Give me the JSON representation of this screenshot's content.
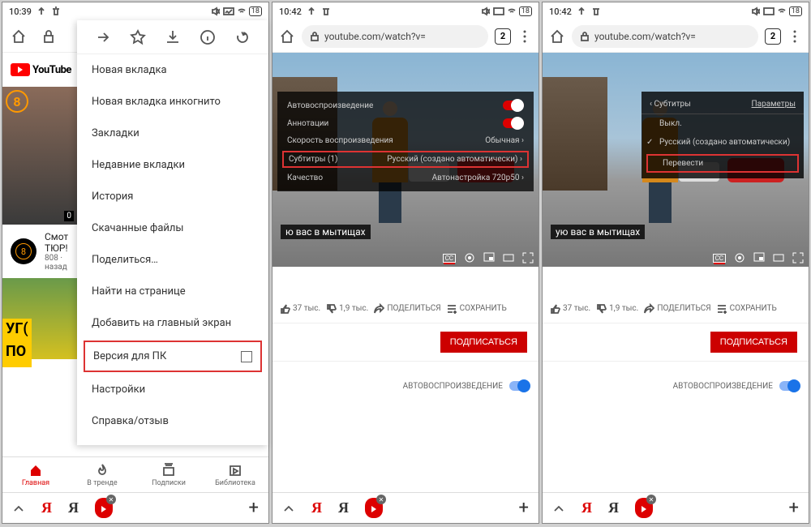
{
  "phone1": {
    "time": "10:39",
    "battery": "18",
    "menu_toolbar": [
      "forward",
      "star",
      "download",
      "info",
      "reload"
    ],
    "menu": {
      "items": [
        "Новая вкладка",
        "Новая вкладка инкогнито",
        "Закладки",
        "Недавние вкладки",
        "История",
        "Скачанные файлы",
        "Поделиться…",
        "Найти на странице",
        "Добавить на главный экран"
      ],
      "highlighted": "Версия для ПК",
      "after": [
        "Настройки",
        "Справка/отзыв"
      ]
    },
    "yt_logo": "YouTube",
    "thumb_time": "0",
    "list_title": "Смот",
    "list_title2": "ТЮР!",
    "list_meta": "808 ·",
    "list_meta2": "назад",
    "bottom_text1": "УГ(",
    "bottom_text2": "ПО",
    "nav": [
      "Главная",
      "В тренде",
      "Подписки",
      "Библиотека"
    ]
  },
  "phone2": {
    "time": "10:42",
    "battery": "18",
    "url": "youtube.com/watch?v=",
    "tabs": "2",
    "panel": {
      "autoplay": "Автовоспроизведение",
      "annotations": "Аннотации",
      "speed": "Скорость воспроизведения",
      "speed_val": "Обычная",
      "subtitles": "Субтитры (1)",
      "subtitles_val": "Русский (создано автоматически)",
      "quality": "Качество",
      "quality_val": "Автонастройка 720p50"
    },
    "subtitle_text": "ю вас в мытищах",
    "actions": {
      "like": "37 тыс.",
      "dislike": "1,9 тыс.",
      "share": "ПОДЕЛИТЬСЯ",
      "save": "СОХРАНИТЬ"
    },
    "subscribe": "ПОДПИСАТЬСЯ",
    "autoplay_label": "АВТОВОСПРОИЗВЕДЕНИЕ"
  },
  "phone3": {
    "time": "10:42",
    "battery": "18",
    "url": "youtube.com/watch?v=",
    "tabs": "2",
    "sub_panel": {
      "back": "Субтитры",
      "params": "Параметры",
      "off": "Выкл.",
      "ru": "Русский (создано автоматически)",
      "translate": "Перевести"
    },
    "subtitle_text": "ую вас в мытищах",
    "actions": {
      "like": "37 тыс.",
      "dislike": "1,9 тыс.",
      "share": "ПОДЕЛИТЬСЯ",
      "save": "СОХРАНИТЬ"
    },
    "subscribe": "ПОДПИСАТЬСЯ",
    "autoplay_label": "АВТОВОСПРОИЗВЕДЕНИЕ"
  }
}
